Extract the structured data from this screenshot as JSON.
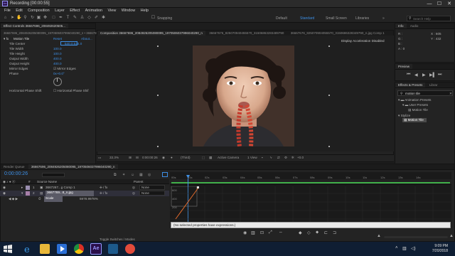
{
  "window": {
    "title": "Recording [00:00:55]",
    "minimize": "—",
    "maximize": "☐",
    "close": "✕"
  },
  "menu": [
    "File",
    "Edit",
    "Composition",
    "Layer",
    "Effect",
    "Animation",
    "View",
    "Window",
    "Help"
  ],
  "toolbar": {
    "snapping": "Snapping",
    "workspaces": [
      "Default",
      "Standard",
      "Small Screen",
      "Libraries"
    ],
    "active_workspace": "Standard",
    "search_placeholder": "Search Help"
  },
  "effect_controls": {
    "tab_label": "Effect Controls 36667696_208492620505...",
    "layer_path": "36667696_2084926205080095_1970506037996040290_n • 36667696_2",
    "effect_name": "Motion Tile",
    "reset": "Reset",
    "about": "About...",
    "properties": [
      {
        "name": "Tile Center",
        "value": "540.0,534.0"
      },
      {
        "name": "Tile Width",
        "value": "100.0"
      },
      {
        "name": "Tile Height",
        "value": "100.0"
      },
      {
        "name": "Output Width",
        "value": "400.0"
      },
      {
        "name": "Output Height",
        "value": "400.0"
      },
      {
        "name": "Mirror Edges",
        "value": "☑ Mirror Edges"
      },
      {
        "name": "Phase",
        "value": "0x+0.0°"
      },
      {
        "name": "Horizontal Phase Shift",
        "value": "☐ Horizontal Phase Shif"
      }
    ]
  },
  "composition": {
    "tabs": [
      "Composition 36667696_2084926205080095_1970506037996040290_n",
      "36667676_825070940455570_31506863283489790",
      "36667676_825070904055570_3150686328349790_n.jpg Comp 1"
    ],
    "status": "Display Acceleration Disabled",
    "zoom": "33.3%",
    "timecode": "0:00:00:26",
    "resolution": "(Third)",
    "camera": "Active Camera",
    "views": "1 View",
    "exposure": "+0.0"
  },
  "info_panel": {
    "tabs": [
      "Info",
      "Audio"
    ],
    "lines": [
      "R :",
      "G :",
      "B :",
      "A : 0"
    ],
    "coords": [
      "X : 605",
      "Y : 432"
    ]
  },
  "preview_panel": {
    "title": "Preview"
  },
  "effects_presets": {
    "tabs": [
      "Effects & Presets",
      "Librar"
    ],
    "search_value": "motion tile",
    "tree": [
      {
        "label": "Animation Presets",
        "level": 0
      },
      {
        "label": "User Presets",
        "level": 1
      },
      {
        "label": "Motion Tile",
        "level": 2
      },
      {
        "label": "Stylize",
        "level": 0
      },
      {
        "label": "Motion Tile",
        "level": 1
      }
    ]
  },
  "timeline": {
    "tabs": [
      "Render Queue",
      "36667696_2084926205080095_1970506037996040290_n"
    ],
    "timecode": "0:00:00:26",
    "columns": [
      "#",
      "Source Name",
      "Parent"
    ],
    "layers": [
      {
        "index": "1",
        "name": "3667267...g Comp 1",
        "parent": "None"
      },
      {
        "index": "2",
        "name": "3667769...8_n.jpg",
        "parent": "None"
      }
    ],
    "property": {
      "name": "Scale",
      "value": "5978.9978%"
    },
    "ruler": [
      "00s",
      "01s",
      "02s",
      "03s",
      "04s",
      "05s",
      "06s",
      "07s",
      "08s",
      "09s",
      "10s",
      "11s",
      "12s",
      "13s",
      "14s"
    ],
    "graph_values": [
      "600",
      "400",
      "200"
    ],
    "expression_msg": "(No selected properties have expressions.)",
    "toggle_label": "Toggle Switches / Modes"
  },
  "taskbar": {
    "time": "9:09 PM",
    "date": "7/20/2018"
  },
  "colors": {
    "accent": "#3d8fe5",
    "ae_purple": "#2a0f4a",
    "green_bar": "#3fae49",
    "graph_line": "#e06a2c"
  }
}
